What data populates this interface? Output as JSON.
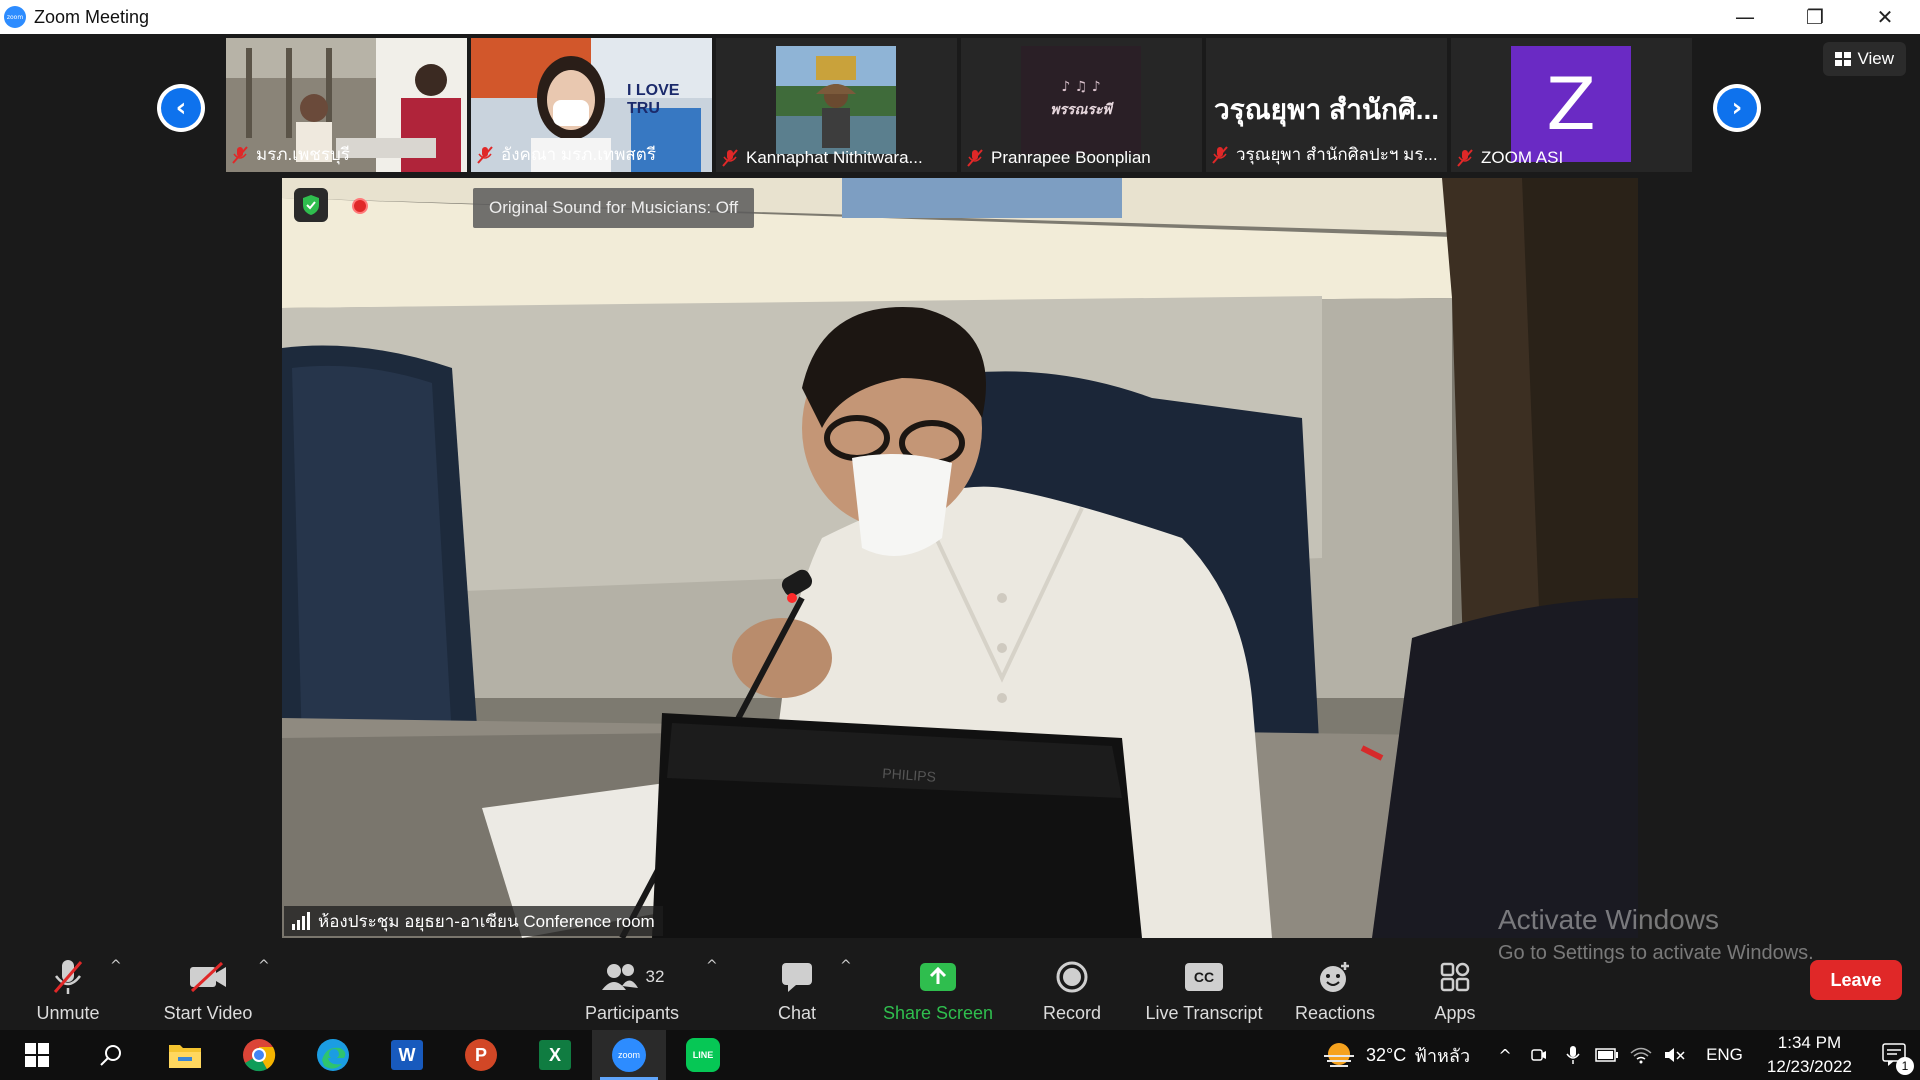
{
  "window": {
    "title": "Zoom Meeting",
    "app_icon_text": "zoom",
    "controls": [
      "—",
      "❐",
      "✕"
    ]
  },
  "thumbnails": [
    {
      "name": "มรภ.เพชรบุรี",
      "muted": true
    },
    {
      "name": "อังคณา มรภ.เทพสตรี",
      "muted": true,
      "banner_text": "I LOVE TRU"
    },
    {
      "name": "Kannaphat Nithitwara...",
      "muted": true
    },
    {
      "name": "Pranrapee Boonplian",
      "muted": true,
      "logo_text": "พรรณระพี"
    },
    {
      "name": "วรุณยุพา สำนักศิลปะฯ มร...",
      "muted": true,
      "big_name": "วรุณยุพา สำนักศิ..."
    },
    {
      "name": "ZOOM ASI",
      "muted": true,
      "avatar_letter": "Z"
    }
  ],
  "view_button": {
    "label": "View"
  },
  "speaker": {
    "name": "ห้องประชุม อยุธยา-อาเซียน Conference room",
    "sound_tooltip": "Original Sound for Musicians: Off",
    "monitor_brand": "PHILIPS"
  },
  "toolbar": {
    "unmute": "Unmute",
    "start_video": "Start Video",
    "participants": "Participants",
    "participants_count": "32",
    "chat": "Chat",
    "share_screen": "Share Screen",
    "record": "Record",
    "live_transcript": "Live Transcript",
    "cc_text": "CC",
    "reactions": "Reactions",
    "apps": "Apps",
    "leave": "Leave"
  },
  "watermark": {
    "line1": "Activate Windows",
    "line2": "Go to Settings to activate Windows."
  },
  "taskbar": {
    "apps": [
      "start-button",
      "search",
      "file-explorer",
      "chrome",
      "edge",
      "word",
      "powerpoint",
      "excel",
      "zoom",
      "line"
    ],
    "weather_temp": "32°C",
    "weather_desc": "ฟ้าหลัว",
    "language": "ENG",
    "time": "1:34 PM",
    "date": "12/23/2022",
    "notification_count": "1",
    "zoom_icon_text": "zoom",
    "line_icon_text": "LINE",
    "word_letter": "W",
    "powerpoint_letter": "P",
    "excel_letter": "X"
  },
  "colors": {
    "zoom_blue": "#0e72ed",
    "share_green": "#2fbe4e",
    "leave_red": "#e02828",
    "avatar_purple": "#6a2ac4"
  }
}
